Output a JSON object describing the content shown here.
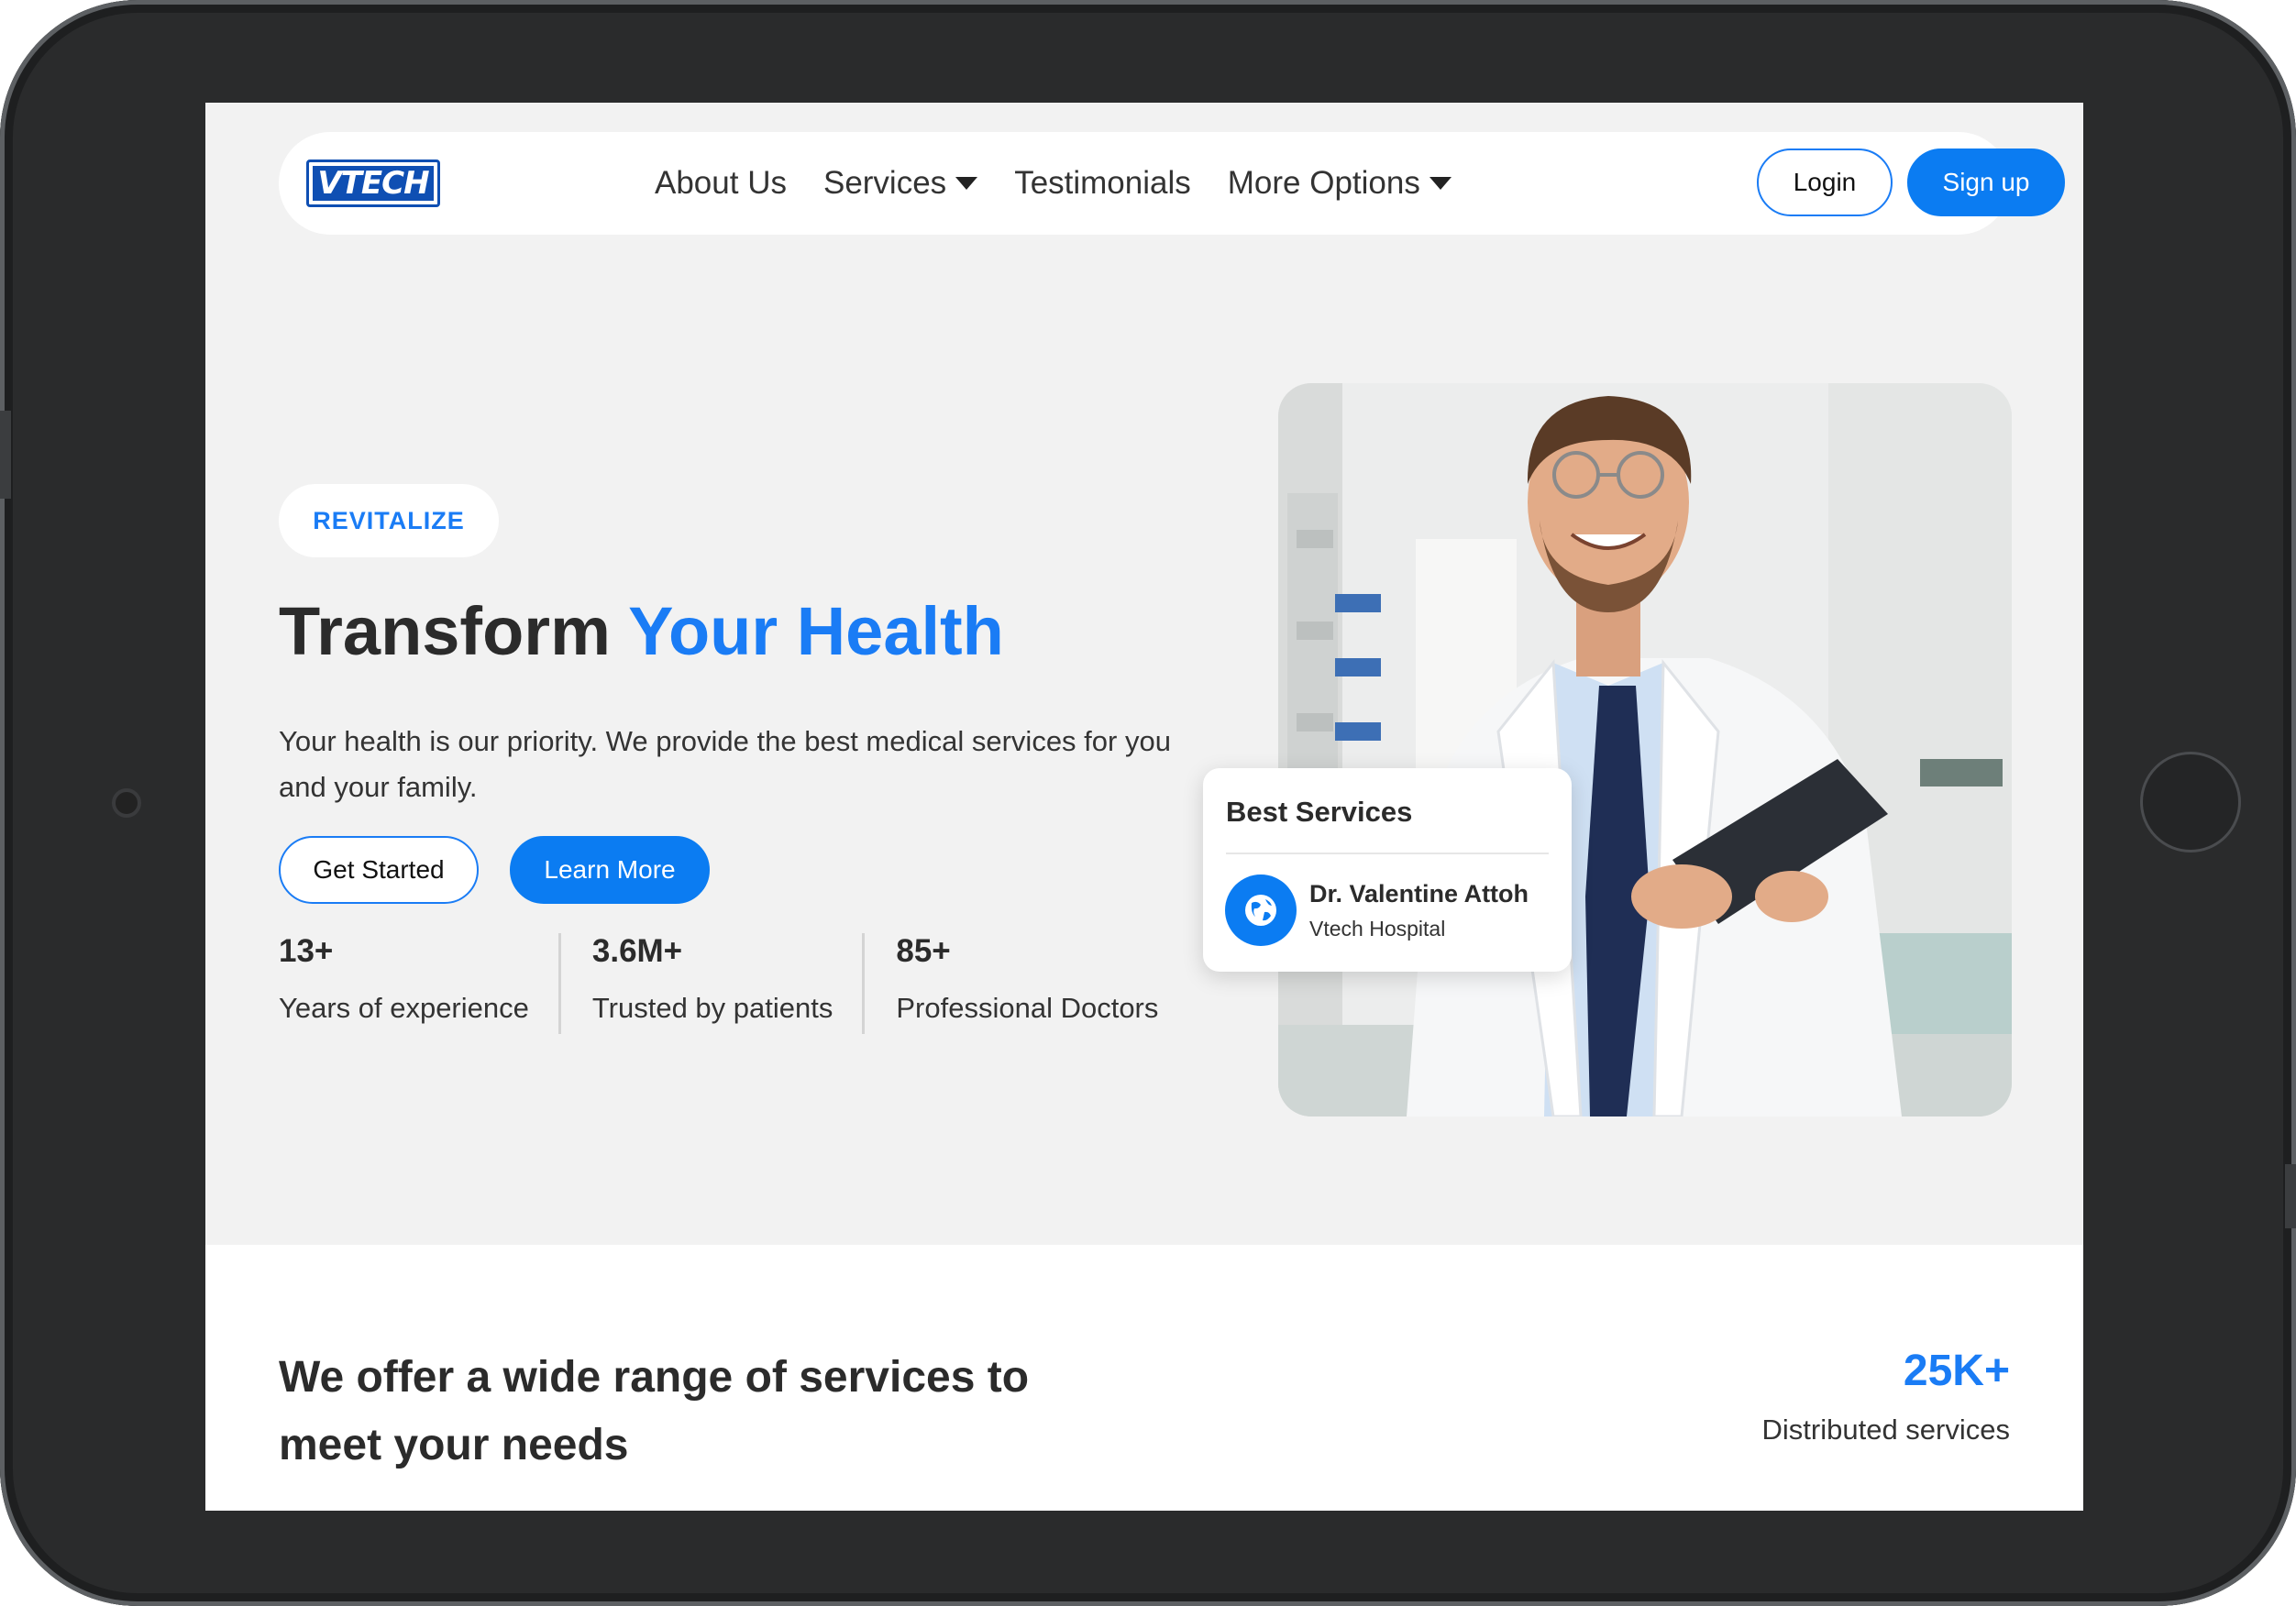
{
  "brand": {
    "logo_text": "VTECH"
  },
  "nav": {
    "links": [
      {
        "label": "About Us",
        "has_caret": false
      },
      {
        "label": "Services",
        "has_caret": true
      },
      {
        "label": "Testimonials",
        "has_caret": false
      },
      {
        "label": "More Options",
        "has_caret": true
      }
    ],
    "login_label": "Login",
    "signup_label": "Sign up"
  },
  "hero": {
    "tag": "REVITALIZE",
    "headline_part1": "Transform ",
    "headline_part2": "Your Health",
    "lead": "Your health is our priority. We provide the best medical services for you and your family.",
    "primary_cta": "Get Started",
    "secondary_cta": "Learn More",
    "stats": [
      {
        "value": "13+",
        "label": "Years of experience"
      },
      {
        "value": "3.6M+",
        "label": "Trusted by patients"
      },
      {
        "value": "85+",
        "label": "Professional Doctors"
      }
    ]
  },
  "card": {
    "title": "Best Services",
    "doctor_name": "Dr. Valentine Attoh",
    "hospital": "Vtech Hospital",
    "avatar_icon": "globe-icon"
  },
  "services": {
    "title": "We offer a wide range of services to meet your needs",
    "count": "25K+",
    "count_label": "Distributed services"
  },
  "colors": {
    "accent": "#1a7cf5",
    "button_blue": "#0b7cf2",
    "screen_bg": "#f2f2f2",
    "text_dark": "#2b2b2b",
    "frame": "#2a2b2c"
  }
}
